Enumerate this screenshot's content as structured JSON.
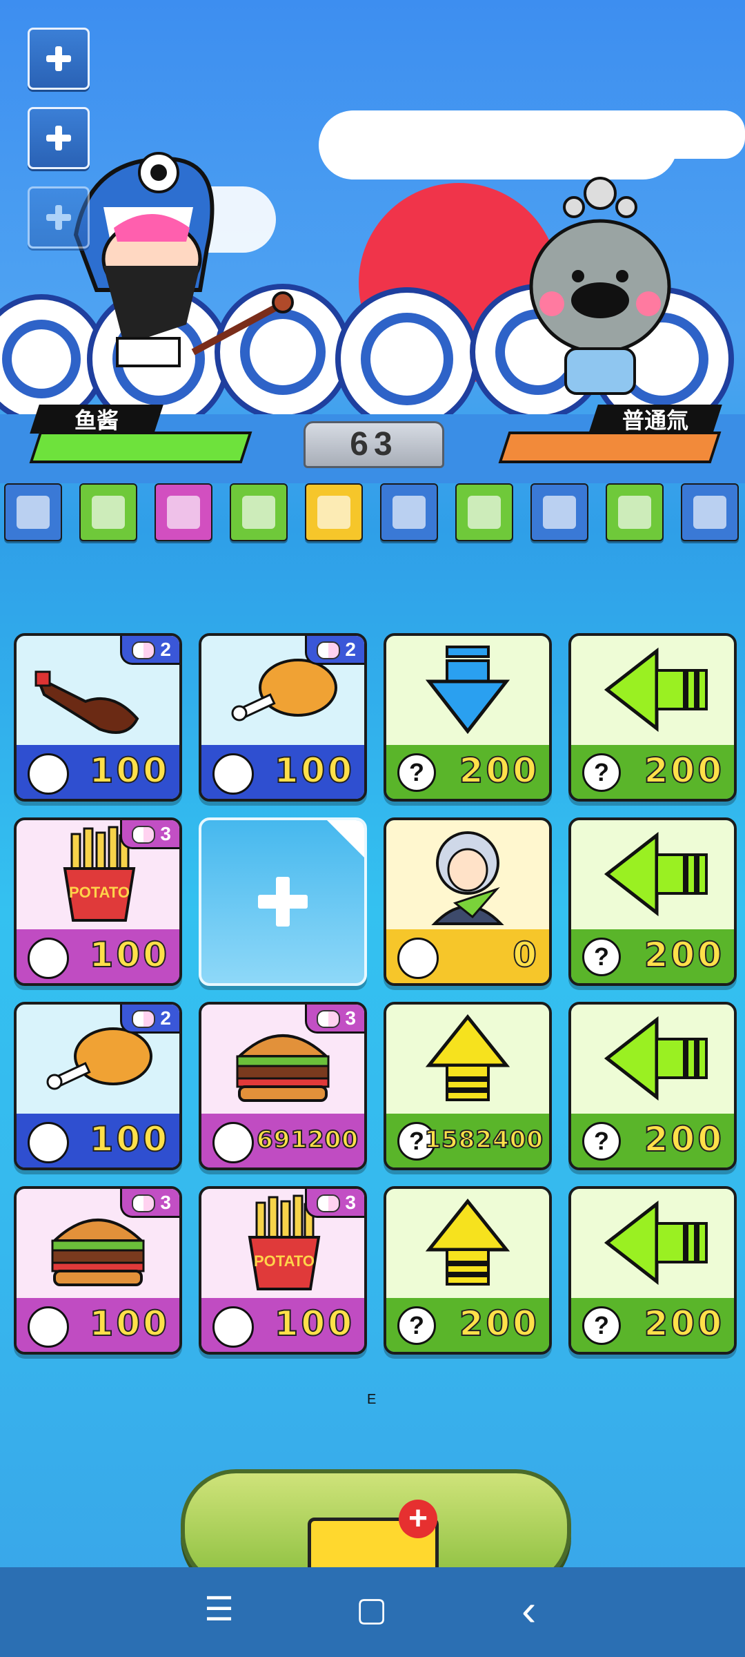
{
  "players": {
    "left_name": "鱼酱",
    "right_name": "普通氚",
    "round_number": "63",
    "left_hp_pct": 100,
    "right_hp_pct": 100,
    "left_hp_color": "#6ee23c",
    "right_hp_color": "#f28a3a"
  },
  "side_buttons": [
    {
      "name": "add-slot-1"
    },
    {
      "name": "add-slot-2"
    },
    {
      "name": "add-slot-3"
    }
  ],
  "toolbar": [
    {
      "name": "trash-tool",
      "color": "#3a79d6"
    },
    {
      "name": "map-tool",
      "color": "#6fc93a"
    },
    {
      "name": "calculator-tool",
      "color": "#d24fc0"
    },
    {
      "name": "document-tool",
      "color": "#6fc93a"
    },
    {
      "name": "scroll-tool",
      "color": "#f6c62a"
    },
    {
      "name": "magnifier-tool",
      "color": "#3a79d6"
    },
    {
      "name": "key-tool",
      "color": "#6fc93a"
    },
    {
      "name": "nest-tool",
      "color": "#3a79d6"
    },
    {
      "name": "gun-tool",
      "color": "#6fc93a"
    },
    {
      "name": "can-tool",
      "color": "#3a79d6"
    }
  ],
  "cards": [
    {
      "type": "blue",
      "item": "cola-bottle",
      "badge": "2",
      "currency": "bread-icon",
      "price": "100"
    },
    {
      "type": "blue",
      "item": "chicken-leg",
      "badge": "2",
      "currency": "bread-icon",
      "price": "100"
    },
    {
      "type": "green",
      "item": "arrow-down-blue",
      "badge": "",
      "currency": "question-icon",
      "price": "200"
    },
    {
      "type": "green",
      "item": "arrow-left-green",
      "badge": "",
      "currency": "question-icon",
      "price": "200"
    },
    {
      "type": "pink",
      "item": "french-fries",
      "badge": "3",
      "currency": "bread-icon",
      "price": "100"
    },
    {
      "type": "empty",
      "item": "add-slot",
      "badge": "",
      "currency": "",
      "price": ""
    },
    {
      "type": "gold",
      "item": "scientist",
      "badge": "",
      "currency": "person-icon",
      "price": "0"
    },
    {
      "type": "green",
      "item": "arrow-left-green",
      "badge": "",
      "currency": "question-icon",
      "price": "200"
    },
    {
      "type": "blue",
      "item": "chicken-leg",
      "badge": "2",
      "currency": "bread-icon",
      "price": "100"
    },
    {
      "type": "pink",
      "item": "hamburger",
      "badge": "3",
      "currency": "bread-icon",
      "price": "691200"
    },
    {
      "type": "green",
      "item": "arrow-up-yellow",
      "badge": "",
      "currency": "question-icon",
      "price": "1582400"
    },
    {
      "type": "green",
      "item": "arrow-left-green",
      "badge": "",
      "currency": "question-icon",
      "price": "200"
    },
    {
      "type": "pink",
      "item": "hamburger",
      "badge": "3",
      "currency": "bread-icon",
      "price": "100"
    },
    {
      "type": "pink",
      "item": "french-fries",
      "badge": "3",
      "currency": "bread-icon",
      "price": "100"
    },
    {
      "type": "green",
      "item": "arrow-up-yellow",
      "badge": "",
      "currency": "question-icon",
      "price": "200"
    },
    {
      "type": "green",
      "item": "arrow-left-green",
      "badge": "",
      "currency": "question-icon",
      "price": "200"
    }
  ],
  "tiny_label": "E",
  "fries_text": "POTATO",
  "nav": {
    "menu": "☰",
    "home": "▢",
    "back": "‹"
  }
}
